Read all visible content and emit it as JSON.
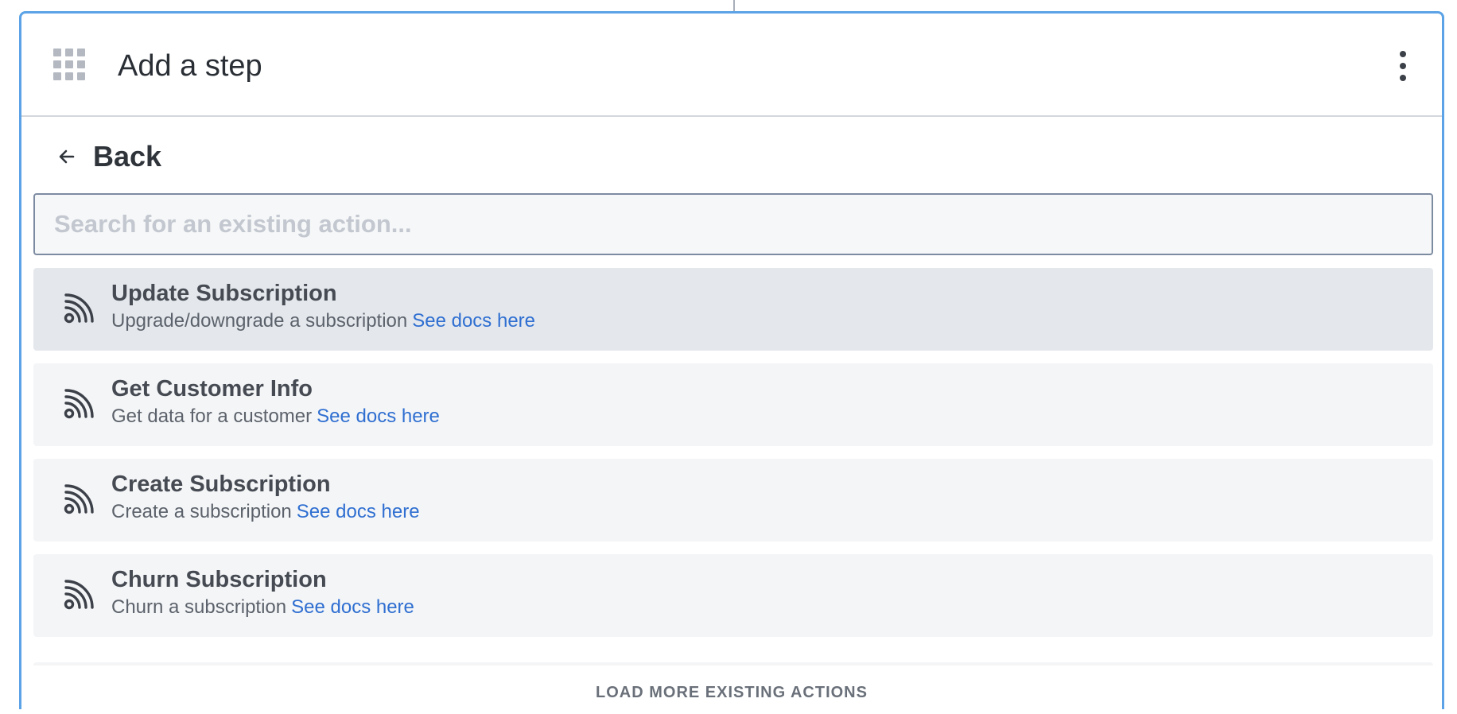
{
  "header": {
    "title": "Add a step",
    "apps_icon": "grid-icon",
    "menu_icon": "more-vertical-icon"
  },
  "back": {
    "label": "Back",
    "icon": "arrow-left-icon"
  },
  "search": {
    "placeholder": "Search for an existing action...",
    "value": ""
  },
  "actions": [
    {
      "title": "Update Subscription",
      "description": "Upgrade/downgrade a subscription",
      "link": "See docs here",
      "icon": "rss-feed-icon",
      "selected": true
    },
    {
      "title": "Get Customer Info",
      "description": "Get data for a customer",
      "link": "See docs here",
      "icon": "rss-feed-icon",
      "selected": false
    },
    {
      "title": "Create Subscription",
      "description": "Create a subscription",
      "link": "See docs here",
      "icon": "rss-feed-icon",
      "selected": false
    },
    {
      "title": "Churn Subscription",
      "description": "Churn a subscription",
      "link": "See docs here",
      "icon": "rss-feed-icon",
      "selected": false
    }
  ],
  "footer": {
    "load_more_label": "LOAD MORE EXISTING ACTIONS"
  },
  "colors": {
    "panel_border": "#5ba3e6",
    "link": "#2f6fd1",
    "selected_row": "#e4e8ed",
    "row": "#f4f5f7"
  }
}
